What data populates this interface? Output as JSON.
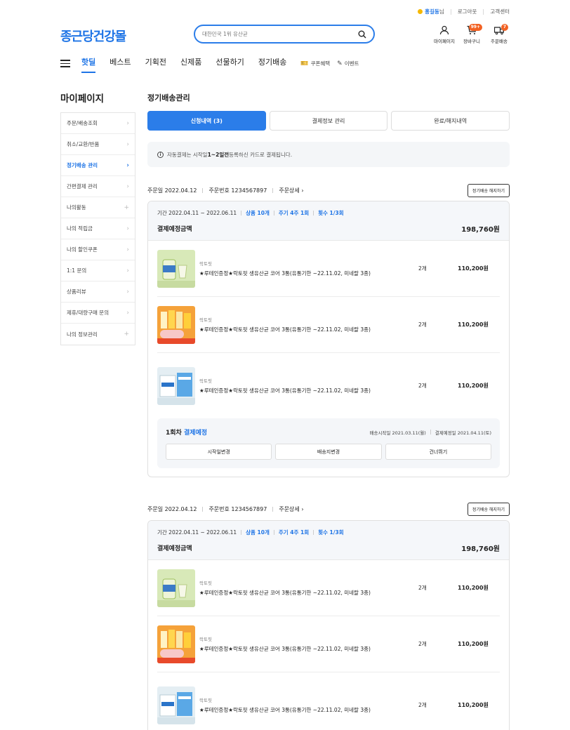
{
  "util": {
    "user": "홍길동",
    "user_suffix": "님",
    "logout": "로그아웃",
    "support": "고객센터"
  },
  "header": {
    "logo": "종근당건강몰",
    "search_placeholder": "대한민국 1위 유산균",
    "mypage": "마이페이지",
    "cart": "장바구니",
    "cart_badge": "99+",
    "delivery": "주문배송",
    "delivery_badge": "7"
  },
  "gnb": {
    "items": [
      "핫딜",
      "베스트",
      "기획전",
      "신제품",
      "선물하기",
      "정기배송"
    ],
    "coupon": "쿠폰혜택",
    "event": "이벤트"
  },
  "sidebar": {
    "title": "마이페이지",
    "items": [
      "주문/배송조회",
      "취소/교환/반품",
      "정기배송 관리",
      "간편결제 관리",
      "나의활동",
      "나의 적립금",
      "나의 할인쿠폰",
      "1:1 문의",
      "상품리뷰",
      "제휴/대량구매 문의",
      "나의 정보관리"
    ]
  },
  "main": {
    "title": "정기배송관리",
    "tabs": [
      "신청내역 (3)",
      "결제정보 관리",
      "완료/해지내역"
    ],
    "notice_pre": "자동결제는 시작일 ",
    "notice_bold": "1~2일전",
    "notice_post": " 등록하신 카드로 결제됩니다."
  },
  "orders": [
    {
      "date": "주문일 2022.04.12",
      "number": "주문번호 1234567897",
      "detail": "주문상세",
      "cancel": "정기배송 해지하기",
      "period": "기간 2022.04.11 ~ 2022.06.11",
      "count": "상품 10개",
      "cycle": "주기 4주 1회",
      "times": "횟수 1/3회",
      "amount_label": "결제예정금액",
      "amount": "198,760원",
      "products": [
        {
          "brand": "락토핏",
          "name": "★루테인증정★락토핏 생유산균 코어 3통(유통기한 ~22.11.02, 미네랄 3종)",
          "qty": "2개",
          "price": "110,200원"
        },
        {
          "brand": "락토핏",
          "name": "★루테인증정★락토핏 생유산균 코어 3통(유통기한 ~22.11.02, 미네랄 3종)",
          "qty": "2개",
          "price": "110,200원"
        },
        {
          "brand": "락토핏",
          "name": "★루테인증정★락토핏 생유산균 코어 3통(유통기한 ~22.11.02, 미네랄 3종)",
          "qty": "2개",
          "price": "110,200원"
        }
      ],
      "payment": {
        "round": "1회차",
        "status": "결제예정",
        "start": "배송시작일 2021.03.11(월)",
        "paydate": "결제예정일 2021.04.11(토)",
        "buttons": [
          "시작일변경",
          "배송지변경",
          "건너뛰기"
        ]
      }
    },
    {
      "date": "주문일 2022.04.12",
      "number": "주문번호 1234567897",
      "detail": "주문상세",
      "cancel": "정기배송 해지하기",
      "period": "기간 2022.04.11 ~ 2022.06.11",
      "count": "상품 10개",
      "cycle": "주기 4주 1회",
      "times": "횟수 1/3회",
      "amount_label": "결제예정금액",
      "amount": "198,760원",
      "products": [
        {
          "brand": "락토핏",
          "name": "★루테인증정★락토핏 생유산균 코어 3통(유통기한 ~22.11.02, 미네랄 3종)",
          "qty": "2개",
          "price": "110,200원"
        },
        {
          "brand": "락토핏",
          "name": "★루테인증정★락토핏 생유산균 코어 3통(유통기한 ~22.11.02, 미네랄 3종)",
          "qty": "2개",
          "price": "110,200원"
        },
        {
          "brand": "락토핏",
          "name": "★루테인증정★락토핏 생유산균 코어 3통(유통기한 ~22.11.02, 미네랄 3종)",
          "qty": "2개",
          "price": "110,200원"
        }
      ]
    }
  ]
}
